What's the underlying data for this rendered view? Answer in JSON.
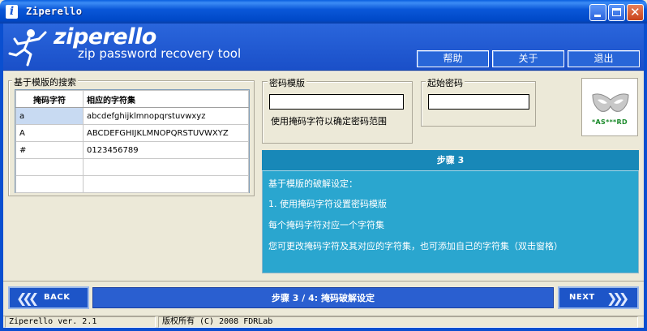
{
  "window": {
    "title": "Ziperello",
    "icon": "info-i-icon"
  },
  "banner": {
    "brand": "ziperello",
    "tagline": "zip password recovery tool",
    "buttons": {
      "help": "帮助",
      "about": "关于",
      "exit": "退出"
    }
  },
  "search_group": {
    "title": "基于模版的搜索",
    "columns": [
      "掩码字符",
      "相应的字符集"
    ],
    "rows": [
      [
        "a",
        "abcdefghijklmnopqrstuvwxyz"
      ],
      [
        "A",
        "ABCDEFGHIJKLMNOPQRSTUVWXYZ"
      ],
      [
        "#",
        "0123456789"
      ],
      [
        "",
        ""
      ],
      [
        "",
        ""
      ]
    ]
  },
  "mask_group": {
    "title": "密码模版",
    "value": "",
    "hint": "使用掩码字符以确定密码范围"
  },
  "start_group": {
    "title": "起始密码",
    "value": ""
  },
  "badge": {
    "text": "*AS***RD"
  },
  "step_panel": {
    "title": "步骤 3",
    "lines": [
      "基于模版的破解设定：",
      "1. 使用掩码字符设置密码模版",
      "每个掩码字符对应一个字符集",
      "您可更改掩码字符及其对应的字符集，也可添加自己的字符集（双击窗格）"
    ]
  },
  "nav": {
    "back": "BACK",
    "next": "NEXT",
    "step_label": "步骤 3 / 4: 掩码破解设定"
  },
  "status": {
    "version": "Ziperello ver. 2.1",
    "copyright": "版权所有 (C) 2008 FDRLab"
  },
  "colors": {
    "titlebar": "#0a57d8",
    "banner": "#1e5bd4",
    "step_panel": "#2aa6cf",
    "step_header": "#1888b8",
    "selected_cell": "#c8daf2"
  }
}
